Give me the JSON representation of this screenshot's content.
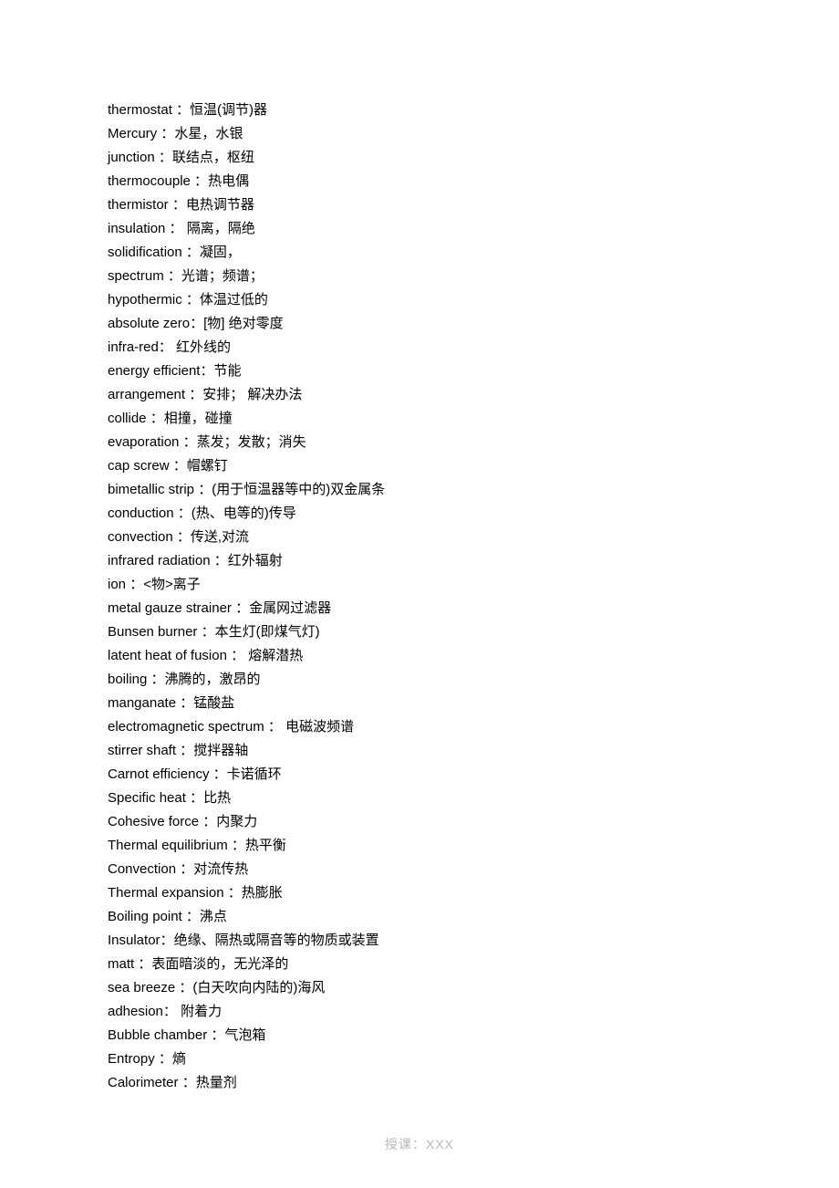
{
  "entries": [
    {
      "term": "thermostat",
      "sep": " ：",
      "def": "恒温(调节)器"
    },
    {
      "term": "Mercury",
      "sep": " ：",
      "def": "水星，水银"
    },
    {
      "term": "junction",
      "sep": " ：",
      "def": "联结点，枢纽"
    },
    {
      "term": "thermocouple",
      "sep": " ：",
      "def": "热电偶"
    },
    {
      "term": "thermistor",
      "sep": " ：",
      "def": "电热调节器"
    },
    {
      "term": "insulation",
      "sep": " ：  ",
      "def": "隔离，隔绝"
    },
    {
      "term": "solidification",
      "sep": " ：",
      "def": "凝固，"
    },
    {
      "term": "spectrum",
      "sep": " ：",
      "def": "光谱；频谱；"
    },
    {
      "term": "hypothermic",
      "sep": " ：",
      "def": "体温过低的"
    },
    {
      "term": "absolute zero",
      "sep": "：",
      "def": "[物]  绝对零度"
    },
    {
      "term": "infra-red",
      "sep": "：  ",
      "def": "红外线的"
    },
    {
      "term": "energy efficient",
      "sep": "：",
      "def": "节能"
    },
    {
      "term": "arrangement",
      "sep": " ：",
      "def": "安排；  解决办法"
    },
    {
      "term": "collide",
      "sep": " ：",
      "def": "相撞，碰撞"
    },
    {
      "term": "evaporation",
      "sep": " ：",
      "def": "蒸发；发散；消失"
    },
    {
      "term": "cap screw",
      "sep": " ：",
      "def": "帽螺钉"
    },
    {
      "term": "bimetallic strip",
      "sep": " ：",
      "def": "(用于恒温器等中的)双金属条"
    },
    {
      "term": "conduction",
      "sep": " ：",
      "def": "(热、电等的)传导"
    },
    {
      "term": "convection",
      "sep": " ：",
      "def": "传送,对流"
    },
    {
      "term": "infrared radiation",
      "sep": " ：",
      "def": "红外辐射"
    },
    {
      "term": "ion",
      "sep": " ：",
      "def": "<物>离子"
    },
    {
      "term": "metal gauze strainer",
      "sep": " ：",
      "def": "金属网过滤器"
    },
    {
      "term": "Bunsen burner",
      "sep": " ：",
      "def": "本生灯(即煤气灯)"
    },
    {
      "term": "latent heat of fusion",
      "sep": " ：  ",
      "def": "熔解潜热"
    },
    {
      "term": "boiling",
      "sep": " ：",
      "def": "沸腾的，激昂的"
    },
    {
      "term": "manganate",
      "sep": " ：",
      "def": "锰酸盐"
    },
    {
      "term": "electromagnetic spectrum",
      "sep": " ：  ",
      "def": "电磁波频谱"
    },
    {
      "term": "stirrer shaft",
      "sep": " ：",
      "def": "搅拌器轴"
    },
    {
      "term": "Carnot efficiency",
      "sep": " ：",
      "def": "卡诺循环"
    },
    {
      "term": "Specific heat",
      "sep": " ：",
      "def": "比热"
    },
    {
      "term": "Cohesive force",
      "sep": " ：",
      "def": "内聚力"
    },
    {
      "term": "Thermal equilibrium",
      "sep": " ：",
      "def": "热平衡"
    },
    {
      "term": "Convection",
      "sep": " ：",
      "def": "对流传热"
    },
    {
      "term": "Thermal expansion",
      "sep": " ：",
      "def": "热膨胀"
    },
    {
      "term": "Boiling point",
      "sep": " ：",
      "def": "沸点"
    },
    {
      "term": "Insulator",
      "sep": "：",
      "def": "绝缘、隔热或隔音等的物质或装置"
    },
    {
      "term": "matt",
      "sep": " ：",
      "def": "表面暗淡的，无光泽的"
    },
    {
      "term": "sea breeze",
      "sep": " ：",
      "def": "(白天吹向内陆的)海风"
    },
    {
      "term": "adhesion",
      "sep": "：  ",
      "def": "附着力"
    },
    {
      "term": "Bubble chamber",
      "sep": " ：",
      "def": "气泡箱"
    },
    {
      "term": "Entropy",
      "sep": " ：",
      "def": "熵"
    },
    {
      "term": "Calorimeter",
      "sep": " ：",
      "def": "热量剂"
    }
  ],
  "footer": "授课：XXX"
}
